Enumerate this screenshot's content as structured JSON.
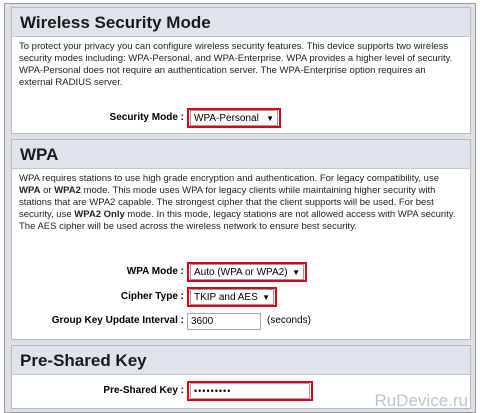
{
  "security_mode_section": {
    "title": "Wireless Security Mode",
    "description": "To protect your privacy you can configure wireless security features. This device supports two wireless security modes including: WPA-Personal, and WPA-Enterprise. WPA provides a higher level of security. WPA-Personal does not require an authentication server. The WPA-Enterprise option requires an external RADIUS server.",
    "security_mode_label": "Security Mode :",
    "security_mode_value": "WPA-Personal"
  },
  "wpa_section": {
    "title": "WPA",
    "desc_1": "WPA requires stations to use high grade encryption and authentication. For legacy compatibility, use ",
    "desc_b1": "WPA",
    "desc_2": " or ",
    "desc_b2": "WPA2",
    "desc_3": " mode. This mode uses WPA for legacy clients while maintaining higher security with stations that are WPA2 capable. The strongest cipher that the client supports will be used. For best security, use ",
    "desc_b3": "WPA2 Only",
    "desc_4": " mode. In this mode, legacy stations are not allowed access with WPA security. The AES cipher will be used across the wireless network to ensure best security.",
    "wpa_mode_label": "WPA Mode :",
    "wpa_mode_value": "Auto (WPA or WPA2)",
    "cipher_type_label": "Cipher Type :",
    "cipher_type_value": "TKIP and AES",
    "group_key_label": "Group Key Update Interval :",
    "group_key_value": "3600",
    "group_key_units": "(seconds)"
  },
  "psk_section": {
    "title": "Pre-Shared Key",
    "psk_label": "Pre-Shared Key :",
    "psk_value": "•••••••••"
  },
  "watermark": "RuDevice.ru",
  "colors": {
    "highlight": "#d9001b",
    "header_bg": "#e1e3ea",
    "frame_bg": "#dfe0e4"
  },
  "icons": [
    "dropdown-arrow-icon"
  ]
}
